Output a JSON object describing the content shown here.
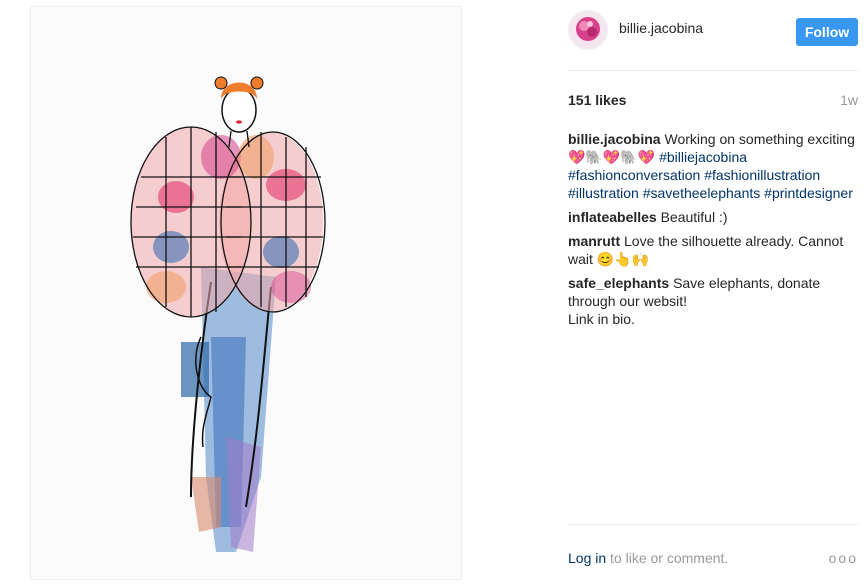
{
  "post": {
    "image_alt": "Fashion illustration of a figure with orange hair in a colorful puffy patchwork jacket and watercolor skirt"
  },
  "header": {
    "username": "billie.jacobina",
    "follow_label": "Follow"
  },
  "stats": {
    "likes": "151 likes",
    "time": "1w"
  },
  "comments": [
    {
      "user": "billie.jacobina",
      "text_before": "Working on something exciting 💖🐘💖🐘💖",
      "hashtags": [
        "#billiejacobina",
        "#fashionconversation",
        "#fashionillustration",
        "#illustration",
        "#savetheelephants",
        "#printdesigner"
      ]
    },
    {
      "user": "inflateabelles",
      "text": "Beautiful :)"
    },
    {
      "user": "manrutt",
      "text": "Love the silhouette already. Cannot wait 😊👆🙌"
    },
    {
      "user": "safe_elephants",
      "text_lines": [
        "Save elephants, donate through our websit!",
        "Link in bio."
      ]
    }
  ],
  "footer": {
    "login": "Log in",
    "rest": "to like or comment.",
    "more": "ooo"
  },
  "colors": {
    "accent": "#3897f0",
    "link": "#003569"
  }
}
